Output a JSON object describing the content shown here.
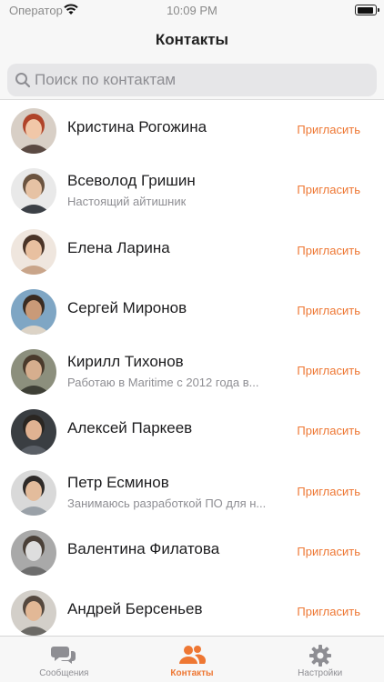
{
  "status_bar": {
    "carrier": "Оператор",
    "time": "10:09 PM",
    "battery_level": 0.92
  },
  "header": {
    "title": "Контакты"
  },
  "search": {
    "placeholder": "Поиск по контактам",
    "value": ""
  },
  "contacts": [
    {
      "name": "Кристина Рогожина",
      "status": "",
      "invite_label": "Пригласить",
      "avatar": "person-woman-red-hair"
    },
    {
      "name": "Всеволод Гришин",
      "status": "Настоящий айтишник",
      "invite_label": "Пригласить",
      "avatar": "person-man"
    },
    {
      "name": "Елена Ларина",
      "status": "",
      "invite_label": "Пригласить",
      "avatar": "person-woman"
    },
    {
      "name": "Сергей Миронов",
      "status": "",
      "invite_label": "Пригласить",
      "avatar": "person-man-outdoors"
    },
    {
      "name": "Кирилл Тихонов",
      "status": "Работаю в Maritime с 2012 года в...",
      "invite_label": "Пригласить",
      "avatar": "person-man"
    },
    {
      "name": "Алексей Паркеев",
      "status": "",
      "invite_label": "Пригласить",
      "avatar": "person-man"
    },
    {
      "name": "Петр Есминов",
      "status": "Занимаюсь разработкой ПО для н...",
      "invite_label": "Пригласить",
      "avatar": "person-man"
    },
    {
      "name": "Валентина Филатова",
      "status": "",
      "invite_label": "Пригласить",
      "avatar": "person-woman"
    },
    {
      "name": "Андрей Берсеньев",
      "status": "",
      "invite_label": "Пригласить",
      "avatar": "person-man"
    }
  ],
  "tabs": [
    {
      "label": "Сообщения",
      "icon": "chat-bubbles-icon",
      "active": false
    },
    {
      "label": "Контакты",
      "icon": "people-icon",
      "active": true
    },
    {
      "label": "Настройки",
      "icon": "gear-icon",
      "active": false
    }
  ],
  "colors": {
    "accent": "#ee7733",
    "inactive": "#8e8e93",
    "bar_background": "#f7f7f7"
  }
}
